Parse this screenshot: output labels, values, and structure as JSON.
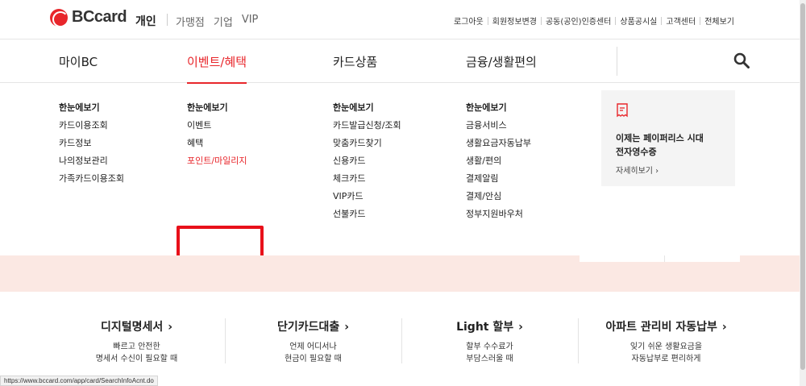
{
  "header": {
    "brand": "BCcard",
    "personal": "개인",
    "biz_links": [
      "가맹점",
      "기업",
      "VIP"
    ],
    "util_links": [
      "로그아웃",
      "회원정보변경",
      "공동(공인)인증센터",
      "상품공시실",
      "고객센터",
      "전체보기"
    ]
  },
  "gnb": {
    "items": [
      "마이BC",
      "이벤트/혜택",
      "카드상품",
      "금융/생활편의"
    ],
    "active_index": 1
  },
  "mega": {
    "col1": [
      "한눈에보기",
      "카드이용조회",
      "카드정보",
      "나의정보관리",
      "가족카드이용조회"
    ],
    "col2": [
      "한눈에보기",
      "이벤트",
      "혜택",
      "포인트/마일리지"
    ],
    "col3": [
      "한눈에보기",
      "카드발급신청/조회",
      "맞춤카드찾기",
      "신용카드",
      "체크카드",
      "VIP카드",
      "선불카드"
    ],
    "col4": [
      "한눈에보기",
      "금융서비스",
      "생활요금자동납부",
      "생활/편의",
      "결제알림",
      "결제/안심",
      "정부지원바우처"
    ],
    "promo": {
      "line1": "이제는 페이퍼리스 시대",
      "line2": "전자영수증",
      "more": "자세히보기 ›"
    }
  },
  "features": [
    {
      "title": "디지털명세서",
      "desc1": "빠르고 안전한",
      "desc2": "명세서 수신이 필요할 때"
    },
    {
      "title": "단기카드대출",
      "desc1": "언제 어디서나",
      "desc2": "현금이 필요할 때"
    },
    {
      "title": "Light 할부",
      "desc1": "할부 수수료가",
      "desc2": "부담스러울 때"
    },
    {
      "title": "아파트 관리비 자동납부",
      "desc1": "잊기 쉬운 생활요금을",
      "desc2": "자동납부로 편리하게"
    }
  ],
  "statusbar": "https://www.bccard.com/app/card/SearchInfoAcnt.do",
  "colors": {
    "accent": "#e8262b",
    "highlight_box": "#e8101a",
    "pink_band": "#fbe8e3",
    "promo_bg": "#f4f4f4"
  }
}
